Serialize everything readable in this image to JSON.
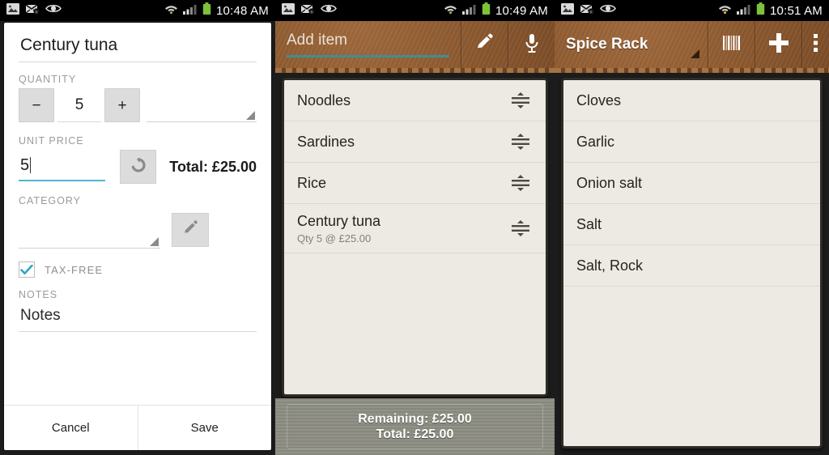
{
  "panel1": {
    "statusbar": {
      "icons": [
        "image-icon",
        "no-sms-icon",
        "eye-icon"
      ],
      "wifi": "wifi-icon",
      "signal": "signal-icon",
      "battery": "battery-icon",
      "time": "10:48 AM"
    },
    "item_name": "Century tuna",
    "quantity": {
      "label": "QUANTITY",
      "minus": "−",
      "value": "5",
      "plus": "+"
    },
    "unit_price": {
      "label": "UNIT PRICE",
      "value": "5",
      "history_icon": "undo-icon",
      "total": "Total: £25.00"
    },
    "category": {
      "label": "CATEGORY",
      "value": "",
      "edit_icon": "pencil-icon"
    },
    "tax_free": {
      "label": "TAX-FREE",
      "checked": true
    },
    "notes": {
      "label": "NOTES",
      "value": "Notes"
    },
    "footer": {
      "cancel": "Cancel",
      "save": "Save"
    }
  },
  "panel2": {
    "statusbar": {
      "time": "10:49 AM"
    },
    "header": {
      "add_placeholder": "Add item",
      "pencil_icon": "pencil-icon",
      "mic_icon": "microphone-icon"
    },
    "items": [
      {
        "title": "Noodles",
        "sub": ""
      },
      {
        "title": "Sardines",
        "sub": ""
      },
      {
        "title": "Rice",
        "sub": ""
      },
      {
        "title": "Century tuna",
        "sub": "Qty 5 @ £25.00"
      }
    ],
    "totals": {
      "remaining": "Remaining: £25.00",
      "total": "Total: £25.00"
    }
  },
  "panel3": {
    "statusbar": {
      "time": "10:51 AM"
    },
    "header": {
      "title": "Spice Rack",
      "barcode_icon": "barcode-icon",
      "add_icon": "plus-icon",
      "overflow_icon": "overflow-menu-icon"
    },
    "items": [
      {
        "title": "Cloves"
      },
      {
        "title": "Garlic"
      },
      {
        "title": "Onion salt"
      },
      {
        "title": "Salt"
      },
      {
        "title": "Salt, Rock"
      }
    ]
  },
  "colors": {
    "leather": "#8d5a30",
    "accent_teal": "#3f8f92",
    "checkbox_blue": "#30a5c9",
    "list_bg": "#eceae3",
    "footer_gray": "#8e8f84"
  }
}
